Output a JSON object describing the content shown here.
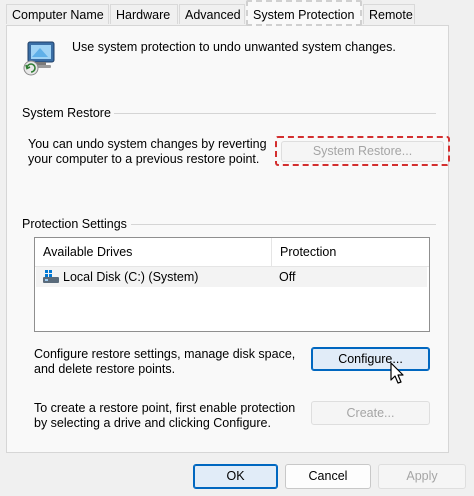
{
  "tabs": [
    {
      "label": "Computer Name"
    },
    {
      "label": "Hardware"
    },
    {
      "label": "Advanced"
    },
    {
      "label": "System Protection"
    },
    {
      "label": "Remote"
    }
  ],
  "intro": {
    "text": "Use system protection to undo unwanted system changes."
  },
  "system_restore": {
    "heading": "System Restore",
    "description_line1": "You can undo system changes by reverting",
    "description_line2": "your computer to a previous restore point.",
    "button_label": "System Restore..."
  },
  "protection": {
    "heading": "Protection Settings",
    "columns": [
      "Available Drives",
      "Protection"
    ],
    "rows": [
      {
        "drive": "Local Disk (C:) (System)",
        "status": "Off"
      }
    ],
    "configure_line1": "Configure restore settings, manage disk space,",
    "configure_line2": "and delete restore points.",
    "configure_button": "Configure...",
    "create_line1": "To create a restore point, first enable protection",
    "create_line2": "by selecting a drive and clicking Configure.",
    "create_button": "Create..."
  },
  "footer": {
    "ok": "OK",
    "cancel": "Cancel",
    "apply": "Apply"
  },
  "colors": {
    "highlight": "#d32f2f",
    "focus": "#0067c0"
  }
}
